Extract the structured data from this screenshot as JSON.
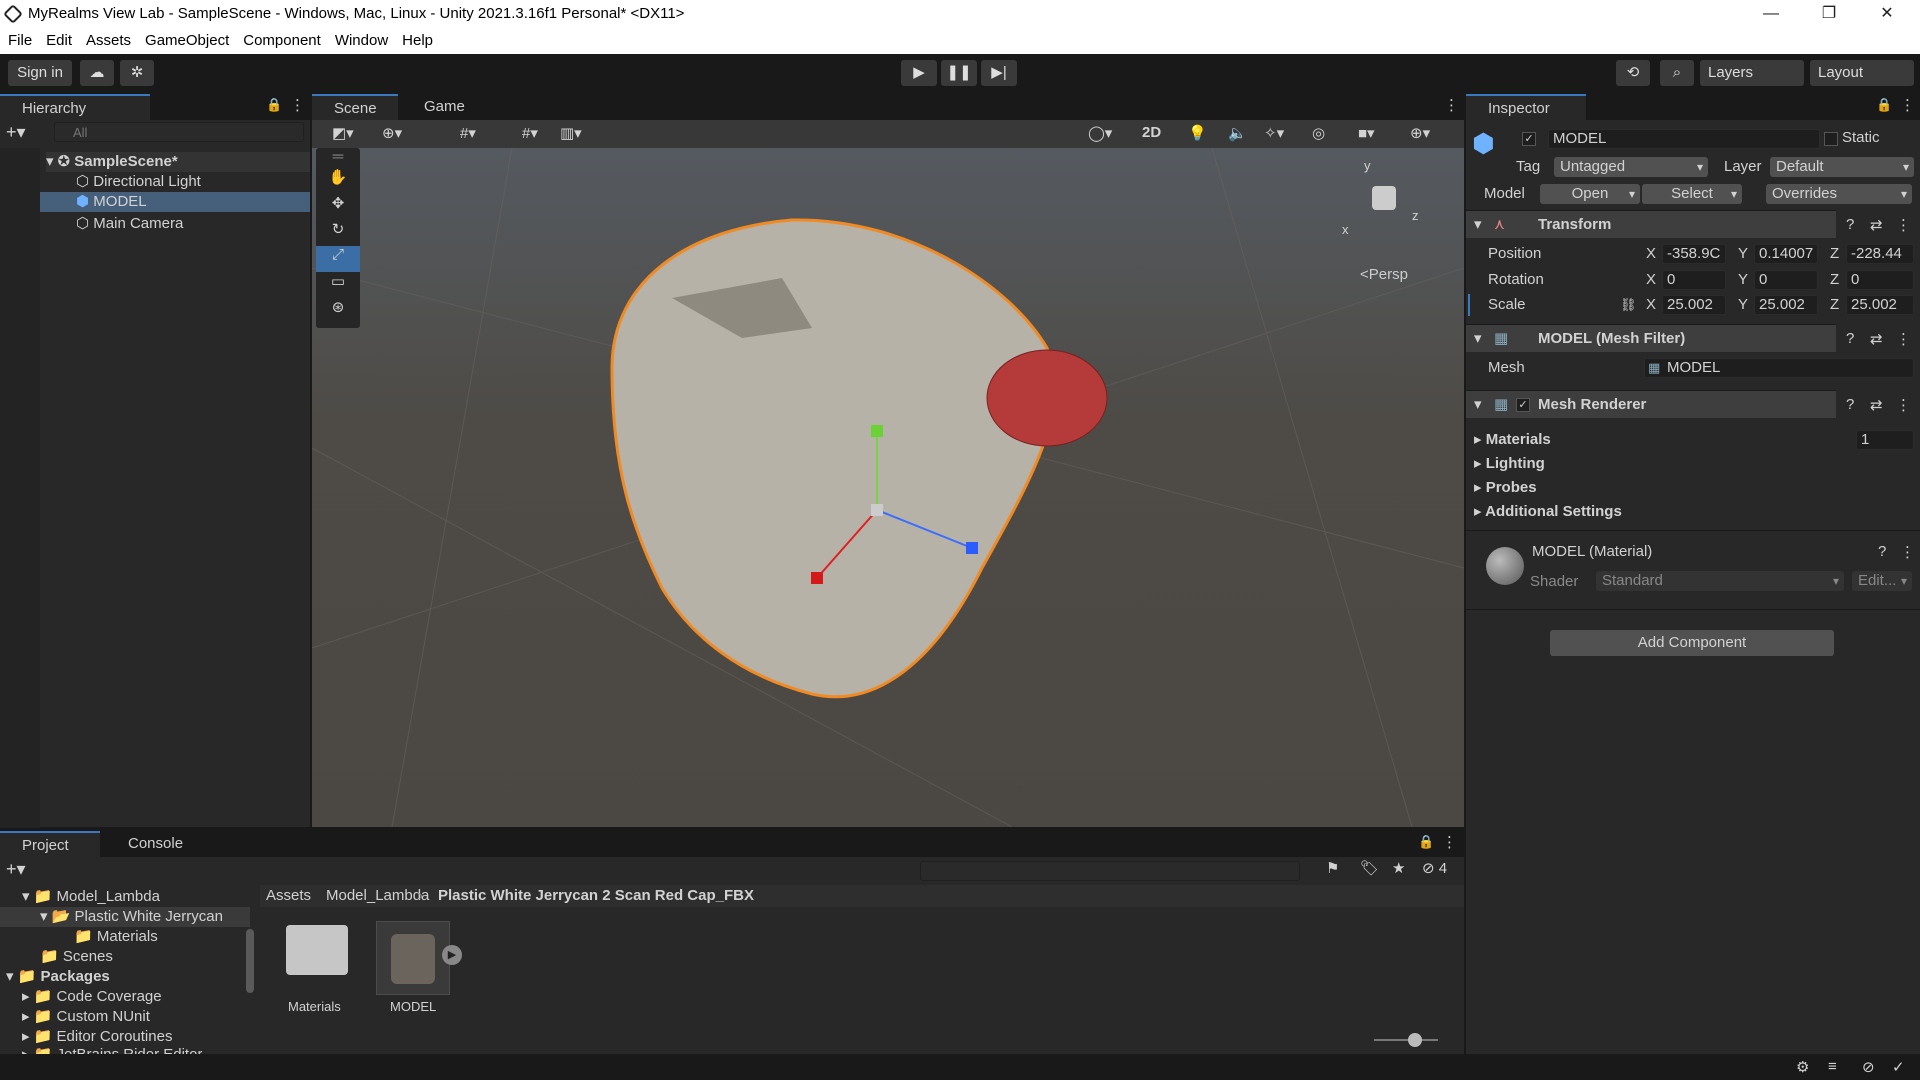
{
  "window": {
    "title": "MyRealms View Lab - SampleScene - Windows, Mac, Linux - Unity 2021.3.16f1 Personal* <DX11>",
    "minimize": "—",
    "maximize": "❐",
    "close": "✕"
  },
  "menu": [
    "File",
    "Edit",
    "Assets",
    "GameObject",
    "Component",
    "Window",
    "Help"
  ],
  "toolbar": {
    "signin": "Sign in",
    "layers": "Layers",
    "layout": "Layout"
  },
  "hierarchy": {
    "tab": "Hierarchy",
    "search_placeholder": "All",
    "scene": "SampleScene*",
    "items": [
      "Directional Light",
      "MODEL",
      "Main Camera"
    ]
  },
  "scene": {
    "tabs": [
      "Scene",
      "Game"
    ],
    "mode_2d": "2D",
    "persp": "<Persp",
    "axis": {
      "x": "x",
      "y": "y",
      "z": "z"
    }
  },
  "inspector": {
    "tab": "Inspector",
    "name": "MODEL",
    "static": "Static",
    "tag_label": "Tag",
    "tag": "Untagged",
    "layer_label": "Layer",
    "layer": "Default",
    "model_label": "Model",
    "open": "Open",
    "select": "Select",
    "overrides": "Overrides",
    "transform": {
      "title": "Transform",
      "position_label": "Position",
      "rotation_label": "Rotation",
      "scale_label": "Scale",
      "position": {
        "x": "-358.9C",
        "y": "0.14007",
        "z": "-228.44"
      },
      "rotation": {
        "x": "0",
        "y": "0",
        "z": "0"
      },
      "scale": {
        "x": "25.002",
        "y": "25.002",
        "z": "25.002"
      },
      "axis_x": "X",
      "axis_y": "Y",
      "axis_z": "Z"
    },
    "mesh_filter": {
      "title": "MODEL (Mesh Filter)",
      "mesh_label": "Mesh",
      "mesh": "MODEL"
    },
    "mesh_renderer": {
      "title": "Mesh Renderer",
      "materials": "Materials",
      "materials_count": "1",
      "lighting": "Lighting",
      "probes": "Probes",
      "additional": "Additional Settings"
    },
    "material": {
      "title": "MODEL (Material)",
      "shader_label": "Shader",
      "shader": "Standard",
      "edit": "Edit..."
    },
    "add_component": "Add Component"
  },
  "project": {
    "tabs": [
      "Project",
      "Console"
    ],
    "badge": "4",
    "tree": [
      "Model_Lambda",
      "Plastic White Jerrycan",
      "Materials",
      "Scenes",
      "Packages",
      "Code Coverage",
      "Custom NUnit",
      "Editor Coroutines",
      "JetBrains Rider Editor"
    ],
    "breadcrumb": [
      "Assets",
      "Model_Lambda",
      "Plastic White Jerrycan 2 Scan Red Cap_FBX"
    ],
    "assets": [
      "Materials",
      "MODEL"
    ]
  },
  "colors": {
    "accent": "#3a79bb",
    "selection": "#f08a24",
    "bg": "#282828"
  }
}
